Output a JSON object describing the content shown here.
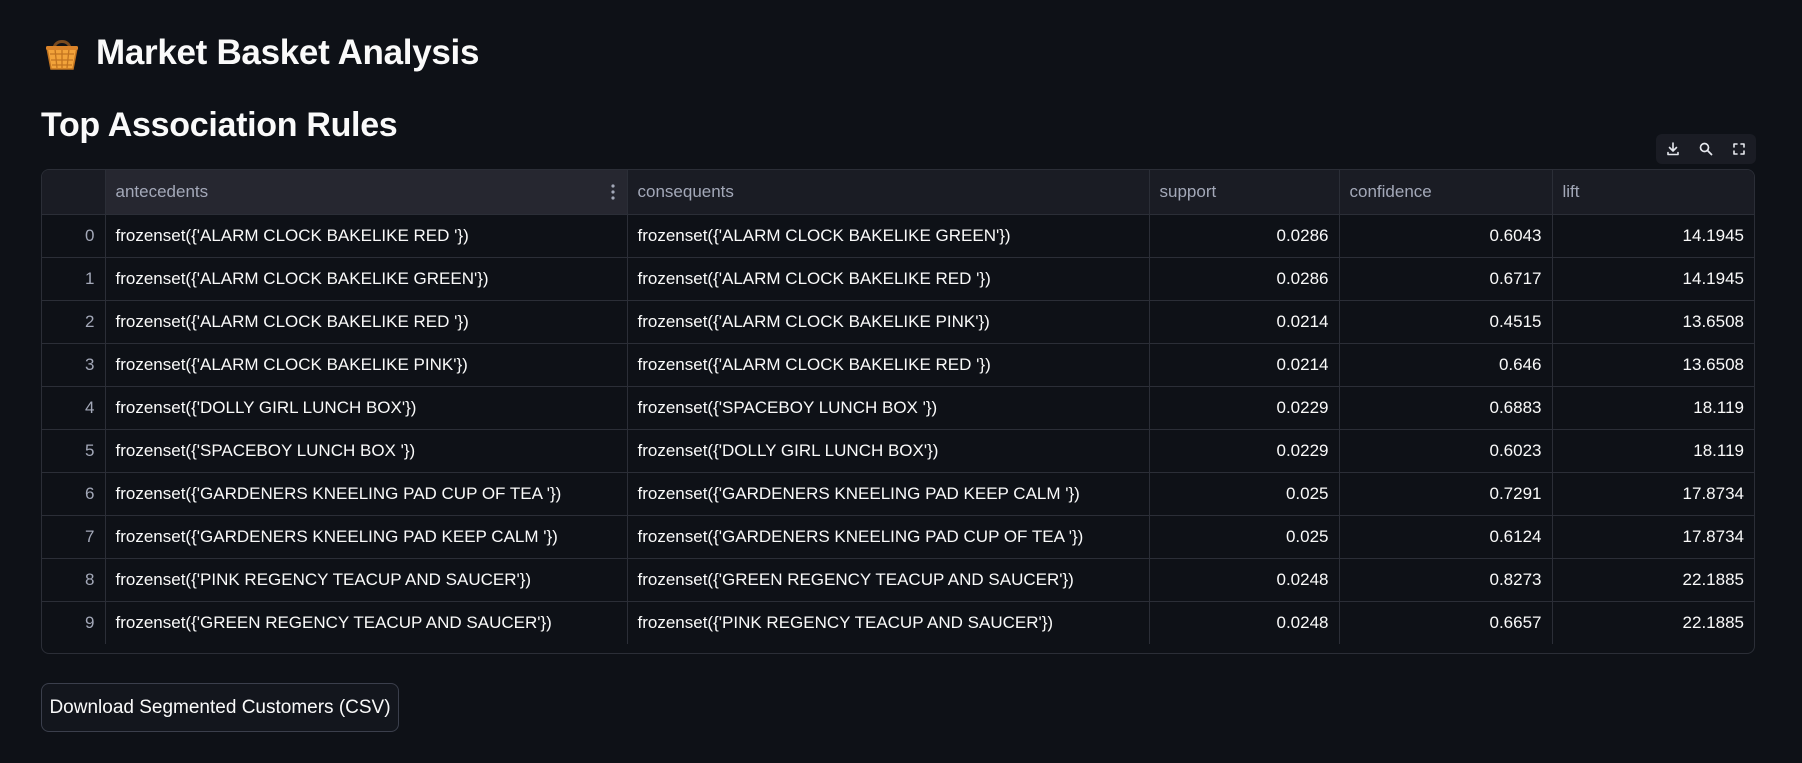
{
  "app": {
    "title": "Market Basket Analysis",
    "icon": "basket-icon"
  },
  "section": {
    "title": "Top Association Rules"
  },
  "toolbar": {
    "icons": [
      "download-icon",
      "search-icon",
      "fullscreen-icon"
    ]
  },
  "table": {
    "columns": [
      "",
      "antecedents",
      "consequents",
      "support",
      "confidence",
      "lift"
    ],
    "rows": [
      {
        "index": "0",
        "antecedents": "frozenset({'ALARM CLOCK BAKELIKE RED '})",
        "consequents": "frozenset({'ALARM CLOCK BAKELIKE GREEN'})",
        "support": "0.0286",
        "confidence": "0.6043",
        "lift": "14.1945"
      },
      {
        "index": "1",
        "antecedents": "frozenset({'ALARM CLOCK BAKELIKE GREEN'})",
        "consequents": "frozenset({'ALARM CLOCK BAKELIKE RED '})",
        "support": "0.0286",
        "confidence": "0.6717",
        "lift": "14.1945"
      },
      {
        "index": "2",
        "antecedents": "frozenset({'ALARM CLOCK BAKELIKE RED '})",
        "consequents": "frozenset({'ALARM CLOCK BAKELIKE PINK'})",
        "support": "0.0214",
        "confidence": "0.4515",
        "lift": "13.6508"
      },
      {
        "index": "3",
        "antecedents": "frozenset({'ALARM CLOCK BAKELIKE PINK'})",
        "consequents": "frozenset({'ALARM CLOCK BAKELIKE RED '})",
        "support": "0.0214",
        "confidence": "0.646",
        "lift": "13.6508"
      },
      {
        "index": "4",
        "antecedents": "frozenset({'DOLLY GIRL LUNCH BOX'})",
        "consequents": "frozenset({'SPACEBOY LUNCH BOX '})",
        "support": "0.0229",
        "confidence": "0.6883",
        "lift": "18.119"
      },
      {
        "index": "5",
        "antecedents": "frozenset({'SPACEBOY LUNCH BOX '})",
        "consequents": "frozenset({'DOLLY GIRL LUNCH BOX'})",
        "support": "0.0229",
        "confidence": "0.6023",
        "lift": "18.119"
      },
      {
        "index": "6",
        "antecedents": "frozenset({'GARDENERS KNEELING PAD CUP OF TEA '})",
        "consequents": "frozenset({'GARDENERS KNEELING PAD KEEP CALM '})",
        "support": "0.025",
        "confidence": "0.7291",
        "lift": "17.8734"
      },
      {
        "index": "7",
        "antecedents": "frozenset({'GARDENERS KNEELING PAD KEEP CALM '})",
        "consequents": "frozenset({'GARDENERS KNEELING PAD CUP OF TEA '})",
        "support": "0.025",
        "confidence": "0.6124",
        "lift": "17.8734"
      },
      {
        "index": "8",
        "antecedents": "frozenset({'PINK REGENCY TEACUP AND SAUCER'})",
        "consequents": "frozenset({'GREEN REGENCY TEACUP AND SAUCER'})",
        "support": "0.0248",
        "confidence": "0.8273",
        "lift": "22.1885"
      },
      {
        "index": "9",
        "antecedents": "frozenset({'GREEN REGENCY TEACUP AND SAUCER'})",
        "consequents": "frozenset({'PINK REGENCY TEACUP AND SAUCER'})",
        "support": "0.0248",
        "confidence": "0.6657",
        "lift": "22.1885"
      }
    ]
  },
  "download": {
    "label": "Download Segmented Customers (CSV)"
  },
  "colors": {
    "background": "#0e1117",
    "header_bg": "#1a1c24",
    "border": "#2b2e37",
    "text": "#fafafa",
    "muted_text": "#a3a8b8"
  }
}
